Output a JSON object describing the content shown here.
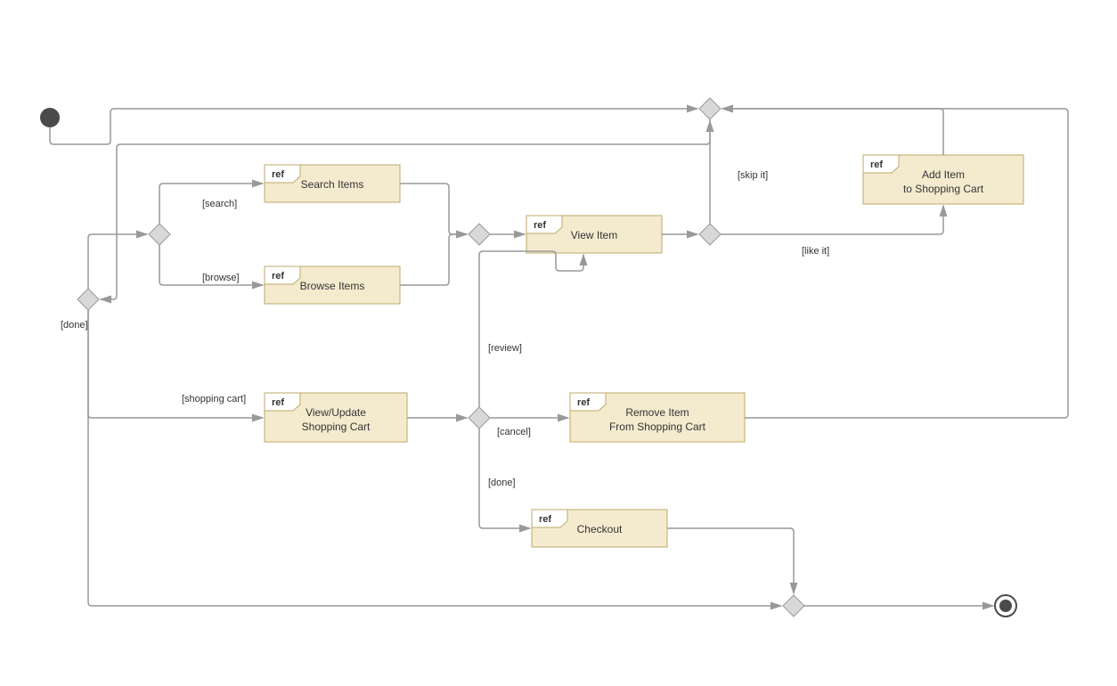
{
  "refs": {
    "search": {
      "label": "ref",
      "text": "Search Items"
    },
    "browse": {
      "label": "ref",
      "text": "Browse Items"
    },
    "view": {
      "label": "ref",
      "text": "View Item"
    },
    "add": {
      "label": "ref",
      "text1": "Add Item",
      "text2": "to Shopping Cart"
    },
    "cart": {
      "label": "ref",
      "text1": "View/Update",
      "text2": "Shopping Cart"
    },
    "remove": {
      "label": "ref",
      "text1": "Remove Item",
      "text2": "From Shopping Cart"
    },
    "checkout": {
      "label": "ref",
      "text": "Checkout"
    }
  },
  "guards": {
    "search": "[search]",
    "browse": "[browse]",
    "shoppingCart": "[shopping cart]",
    "done": "[done]",
    "review": "[review]",
    "cancel": "[cancel]",
    "done2": "[done]",
    "skip": "[skip it]",
    "like": "[like it]"
  },
  "colors": {
    "box": "#f4ebcf",
    "stroke": "#bca96a",
    "edge": "#999",
    "node": "#4a4a4a"
  }
}
